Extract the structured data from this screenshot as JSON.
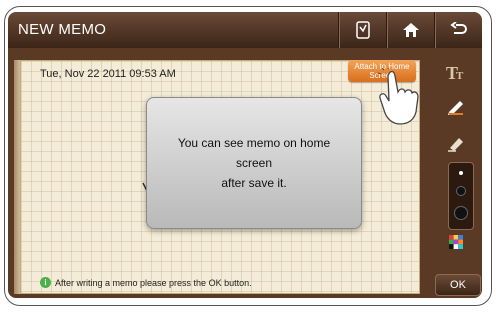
{
  "header": {
    "title": "NEW MEMO",
    "buttons": [
      {
        "icon": "memo-edit-icon"
      },
      {
        "icon": "home-icon"
      },
      {
        "icon": "back-icon"
      }
    ]
  },
  "memo": {
    "date": "Tue, Nov 22 2011 09:53 AM",
    "attach_button": "Attach to Home Screen",
    "hint": "After writing a memo please press the OK button.",
    "hint_icon": "info-icon"
  },
  "popup": {
    "message_line1": "You can see memo on home screen",
    "message_line2": "after save it."
  },
  "toolbar": {
    "tools": [
      {
        "icon": "text-tool-icon"
      },
      {
        "icon": "pen-tool-icon"
      },
      {
        "icon": "eraser-tool-icon"
      },
      {
        "icon": "color-palette-icon"
      }
    ],
    "ok_label": "OK"
  },
  "colors": {
    "accent_orange": "#e07a25",
    "title_bar": "#4a2f1f",
    "paper": "#f4ecd8",
    "hint_icon": "#4bb04b"
  }
}
